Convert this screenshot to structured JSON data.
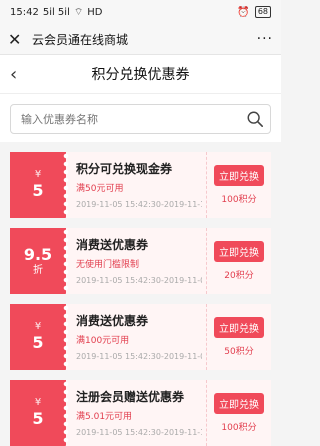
{
  "status_bar": {
    "time": "15:42",
    "signal": "5il 5il",
    "network": "HD",
    "battery": "68"
  },
  "app_header": {
    "title": "云会员通在线商城"
  },
  "nav": {
    "title": "积分兑换优惠券"
  },
  "search": {
    "placeholder": "输入优惠券名称"
  },
  "coupons": [
    {
      "symbol": "¥",
      "amount": "5",
      "suffix": "",
      "name": "积分可兑换现金券",
      "condition": "满50元可用",
      "date": "2019-11-05 15:42:30-2019-11-1...",
      "button": "立即兑换",
      "points": "100积分"
    },
    {
      "symbol": "",
      "amount": "9.5",
      "suffix": "折",
      "name": "消费送优惠券",
      "condition": "无使用门槛限制",
      "date": "2019-11-05 15:42:30-2019-11-0...",
      "button": "立即兑换",
      "points": "20积分"
    },
    {
      "symbol": "¥",
      "amount": "5",
      "suffix": "",
      "name": "消费送优惠券",
      "condition": "满100元可用",
      "date": "2019-11-05 15:42:30-2019-11-0...",
      "button": "立即兑换",
      "points": "50积分"
    },
    {
      "symbol": "¥",
      "amount": "5",
      "suffix": "",
      "name": "注册会员赠送优惠券",
      "condition": "满5.01元可用",
      "date": "2019-11-05 15:42:30-2019-11-1...",
      "button": "立即兑换",
      "points": "100积分"
    }
  ],
  "colors": {
    "accent": "#f04a5a",
    "coupon_bg": "#fff5f5"
  }
}
